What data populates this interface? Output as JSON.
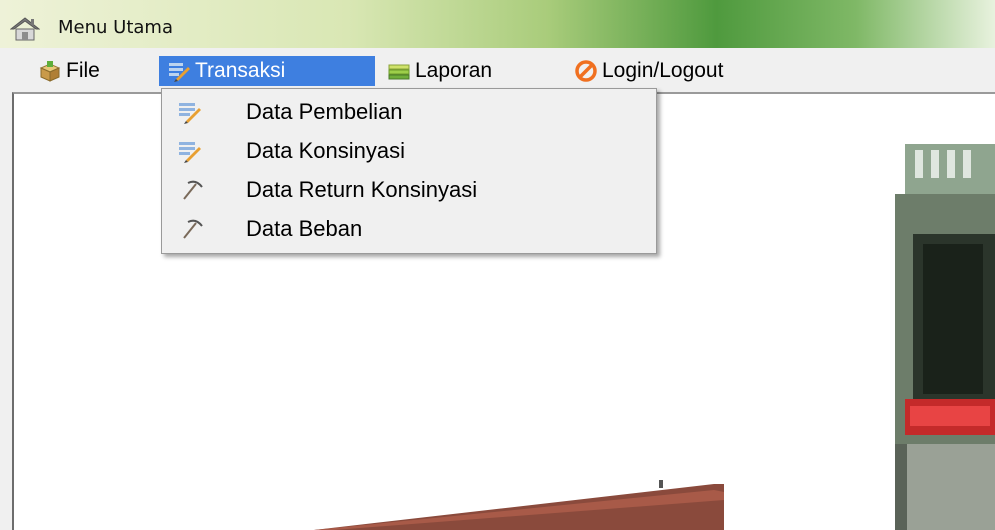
{
  "window": {
    "title": "Menu Utama",
    "icon": "home-icon"
  },
  "menubar": {
    "items": [
      {
        "label": "File",
        "icon": "box-icon",
        "active": false
      },
      {
        "label": "Transaksi",
        "icon": "edit-list-icon",
        "active": true
      },
      {
        "label": "Laporan",
        "icon": "stack-icon",
        "active": false
      },
      {
        "label": "Login/Logout",
        "icon": "prohibited-icon",
        "active": false
      }
    ]
  },
  "dropdown": {
    "parent": "Transaksi",
    "items": [
      {
        "label": "Data Pembelian",
        "icon": "edit-list-icon"
      },
      {
        "label": "Data Konsinyasi",
        "icon": "edit-list-icon"
      },
      {
        "label": "Data Return Konsinyasi",
        "icon": "pickaxe-icon"
      },
      {
        "label": "Data Beban",
        "icon": "pickaxe-icon"
      }
    ]
  },
  "colors": {
    "menu_highlight": "#3e7fe0",
    "window_bg": "#f0f0f0",
    "title_gradient_green": "#4f9a3e"
  }
}
